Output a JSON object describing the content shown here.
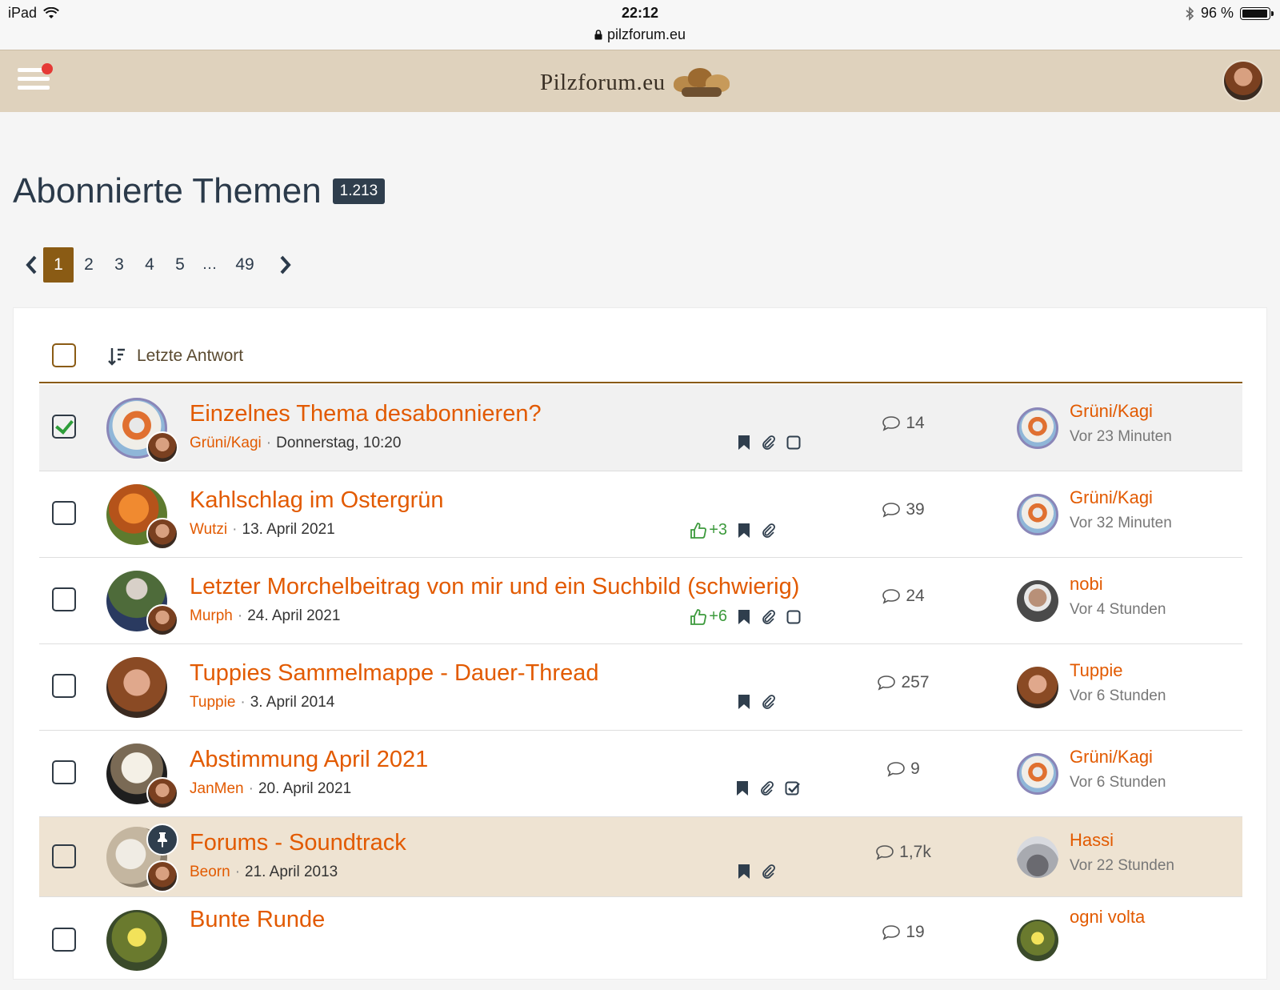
{
  "status_bar": {
    "device": "iPad",
    "time": "22:12",
    "url": "pilzforum.eu",
    "battery": "96 %"
  },
  "header": {
    "logo_text": "Pilzforum.eu"
  },
  "page": {
    "title": "Abonnierte Themen",
    "count": "1.213"
  },
  "pagination": {
    "pages": [
      "1",
      "2",
      "3",
      "4",
      "5"
    ],
    "ellipsis": "…",
    "last": "49",
    "current": "1"
  },
  "list": {
    "sort_label": "Letzte Antwort"
  },
  "threads": [
    {
      "title": "Einzelnes Thema desabonnieren?",
      "author": "Grüni/Kagi",
      "date": "Donnerstag, 10:20",
      "likes": "",
      "replies": "14",
      "last_user": "Grüni/Kagi",
      "last_time": "Vor 23 Minuten"
    },
    {
      "title": "Kahlschlag im Ostergrün",
      "author": "Wutzi",
      "date": "13. April 2021",
      "likes": "+3",
      "replies": "39",
      "last_user": "Grüni/Kagi",
      "last_time": "Vor 32 Minuten"
    },
    {
      "title": "Letzter Morchelbeitrag von mir und ein Suchbild (schwierig)",
      "author": "Murph",
      "date": "24. April 2021",
      "likes": "+6",
      "replies": "24",
      "last_user": "nobi",
      "last_time": "Vor 4 Stunden"
    },
    {
      "title": "Tuppies Sammelmappe - Dauer-Thread",
      "author": "Tuppie",
      "date": "3. April 2014",
      "likes": "",
      "replies": "257",
      "last_user": "Tuppie",
      "last_time": "Vor 6 Stunden"
    },
    {
      "title": "Abstimmung April 2021",
      "author": "JanMen",
      "date": "20. April 2021",
      "likes": "",
      "replies": "9",
      "last_user": "Grüni/Kagi",
      "last_time": "Vor 6 Stunden"
    },
    {
      "title": "Forums - Soundtrack",
      "author": "Beorn",
      "date": "21. April 2013",
      "likes": "",
      "replies": "1,7k",
      "last_user": "Hassi",
      "last_time": "Vor 22 Stunden"
    },
    {
      "title": "Bunte Runde",
      "author": "",
      "date": "",
      "likes": "",
      "replies": "19",
      "last_user": "ogni volta",
      "last_time": ""
    }
  ],
  "colors": {
    "accent": "#8a5b14",
    "link": "#e25a00",
    "header_bg": "#dfd2bd",
    "sticky_bg": "#eee3d2",
    "like": "#3c9a3c"
  }
}
